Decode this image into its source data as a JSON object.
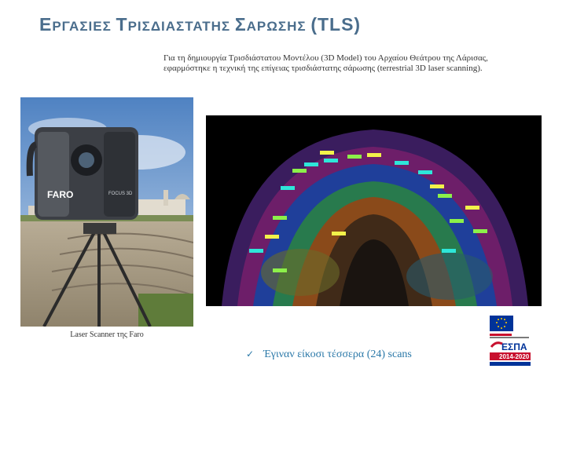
{
  "title": {
    "part1": "Ε",
    "part2": "ΡΓΑΣΙΕΣ ",
    "part3": "Τ",
    "part4": "ΡΙΣΔΙΑΣΤΑΤΗΣ ",
    "part5": "Σ",
    "part6": "ΑΡΩΣΗΣ ",
    "part7": "(TLS)"
  },
  "intro": "Για τη δημιουργία Τρισδιάστατου Μοντέλου (3D Model) του Αρχαίου Θεάτρου της Λάρισας, εφαρμόστηκε η τεχνική της επίγειας τρισδιάστατης σάρωσης (terrestrial 3D laser scanning).",
  "photo": {
    "caption": "Laser Scanner της Faro",
    "brand": "FARO",
    "model": "FOCUS 3D"
  },
  "bullet": {
    "text": "Έγιναν είκοσι τέσσερα (24) scans"
  },
  "logo": {
    "text": "ΕΣΠΑ",
    "years": "2014-2020"
  },
  "colors": {
    "title": "#4a6d8c",
    "bullet": "#2a78a8",
    "espa_red": "#c8102e",
    "eu_blue": "#003399"
  }
}
